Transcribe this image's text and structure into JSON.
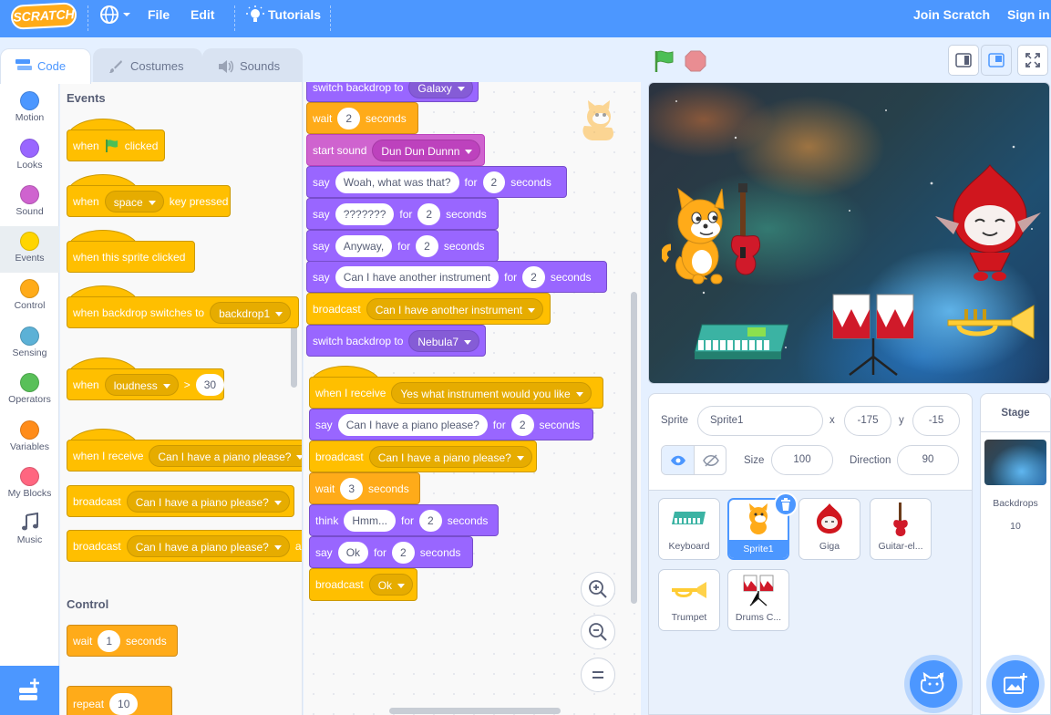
{
  "menubar": {
    "logo": "SCRATCH",
    "file": "File",
    "edit": "Edit",
    "tutorials": "Tutorials",
    "join": "Join Scratch",
    "signin": "Sign in"
  },
  "tabs": {
    "code": "Code",
    "costumes": "Costumes",
    "sounds": "Sounds"
  },
  "categories": [
    {
      "label": "Motion",
      "color": "#4c97ff"
    },
    {
      "label": "Looks",
      "color": "#9966ff"
    },
    {
      "label": "Sound",
      "color": "#cf63cf"
    },
    {
      "label": "Events",
      "color": "#ffd500"
    },
    {
      "label": "Control",
      "color": "#ffab19"
    },
    {
      "label": "Sensing",
      "color": "#5cb1d6"
    },
    {
      "label": "Operators",
      "color": "#59c059"
    },
    {
      "label": "Variables",
      "color": "#ff8c1a"
    },
    {
      "label": "My Blocks",
      "color": "#ff6680"
    },
    {
      "label": "Music",
      "color": "#0fbd8c"
    }
  ],
  "palette": {
    "events_heading": "Events",
    "control_heading": "Control",
    "when": "when",
    "clicked": "clicked",
    "key_pressed": "key pressed",
    "space": "space",
    "sprite_clicked": "when this sprite clicked",
    "backdrop_switches": "when backdrop switches to",
    "backdrop1": "backdrop1",
    "loudness": "loudness",
    "gt": ">",
    "loudness_value": "30",
    "when_receive": "when I receive",
    "receive_msg": "Can I have a piano please?",
    "broadcast": "broadcast",
    "broadcast_msg": "Can I have a piano please?",
    "broadcast2_msg": "Can I have a piano please?",
    "broadcast2_tail": "an",
    "wait": "wait",
    "wait_value": "1",
    "seconds": "seconds",
    "repeat": "repeat",
    "repeat_value": "10"
  },
  "script1": {
    "switch_backdrop": "switch backdrop to",
    "backdrop_galaxy": "Galaxy",
    "wait": "wait",
    "wait_value": "2",
    "seconds": "seconds",
    "start_sound": "start sound",
    "sound_name": "Dun Dun Dunnn",
    "say": "say",
    "for": "for",
    "say1": "Woah, what was that?",
    "say1_secs": "2",
    "say2": "???????",
    "say2_secs": "2",
    "say3": "Anyway,",
    "say3_secs": "2",
    "say4": "Can I have another instrument",
    "say4_secs": "2",
    "broadcast": "broadcast",
    "broadcast_msg": "Can I have another instrument",
    "backdrop_nebula": "Nebula7"
  },
  "script2": {
    "when_receive": "when I receive",
    "receive_msg": "Yes what instrument would you like",
    "say": "say",
    "for": "for",
    "seconds": "seconds",
    "say1": "Can I have a piano please?",
    "say1_secs": "2",
    "broadcast": "broadcast",
    "broadcast_msg": "Can I have a piano please?",
    "wait": "wait",
    "wait_value": "3",
    "think": "think",
    "think_text": "Hmm...",
    "think_secs": "2",
    "say2": "Ok",
    "say2_secs": "2",
    "broadcast2_msg": "Ok"
  },
  "sprite_info": {
    "sprite_label": "Sprite",
    "sprite_name": "Sprite1",
    "x_label": "x",
    "x": "-175",
    "y_label": "y",
    "y": "-15",
    "show_label": "Show",
    "size_label": "Size",
    "size": "100",
    "direction_label": "Direction",
    "direction": "90"
  },
  "sprites": [
    {
      "name": "Keyboard"
    },
    {
      "name": "Sprite1"
    },
    {
      "name": "Giga"
    },
    {
      "name": "Guitar-el..."
    },
    {
      "name": "Trumpet"
    },
    {
      "name": "Drums C..."
    }
  ],
  "stage_panel": {
    "title": "Stage",
    "backdrops_label": "Backdrops",
    "backdrops_count": "10"
  }
}
